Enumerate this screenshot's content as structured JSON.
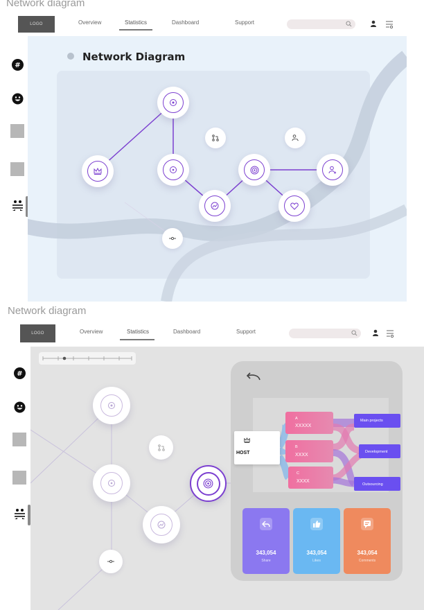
{
  "sections": [
    {
      "title": "Network diagram",
      "canvas_title": "Network Diagram"
    },
    {
      "title": "Network diagram"
    }
  ],
  "topbar": {
    "logo": "LOGO",
    "nav": [
      "Overview",
      "Statistics",
      "Dashboard",
      "Support"
    ],
    "active_nav": "Statistics",
    "search_placeholder": ""
  },
  "sidebar": {
    "icons": [
      "hashtag-icon",
      "smiley-icon",
      "placeholder-square",
      "placeholder-square",
      "users-swap-icon"
    ]
  },
  "sankey": {
    "host_label": "HOST",
    "sources": [
      {
        "letter": "A",
        "value": "XXXXX"
      },
      {
        "letter": "B",
        "value": "XXXX"
      },
      {
        "letter": "C",
        "value": "XXXX"
      }
    ],
    "targets": [
      "Main projects",
      "Development",
      "Outsourcing"
    ]
  },
  "stats": [
    {
      "value": "343,054",
      "label": "Share",
      "color": "#8b78f0",
      "icon": "share-icon"
    },
    {
      "value": "343,054",
      "label": "Likes",
      "color": "#6ab8f2",
      "icon": "like-icon"
    },
    {
      "value": "343,054",
      "label": "Comments",
      "color": "#ef8a5e",
      "icon": "comment-icon"
    }
  ],
  "colors": {
    "accent": "#7b3fd0",
    "canvas_top": "#e9f2fa",
    "canvas_bottom": "#e3e3e3",
    "tag_pink": "#f06fa0",
    "target_purple": "#6a4ff0"
  }
}
